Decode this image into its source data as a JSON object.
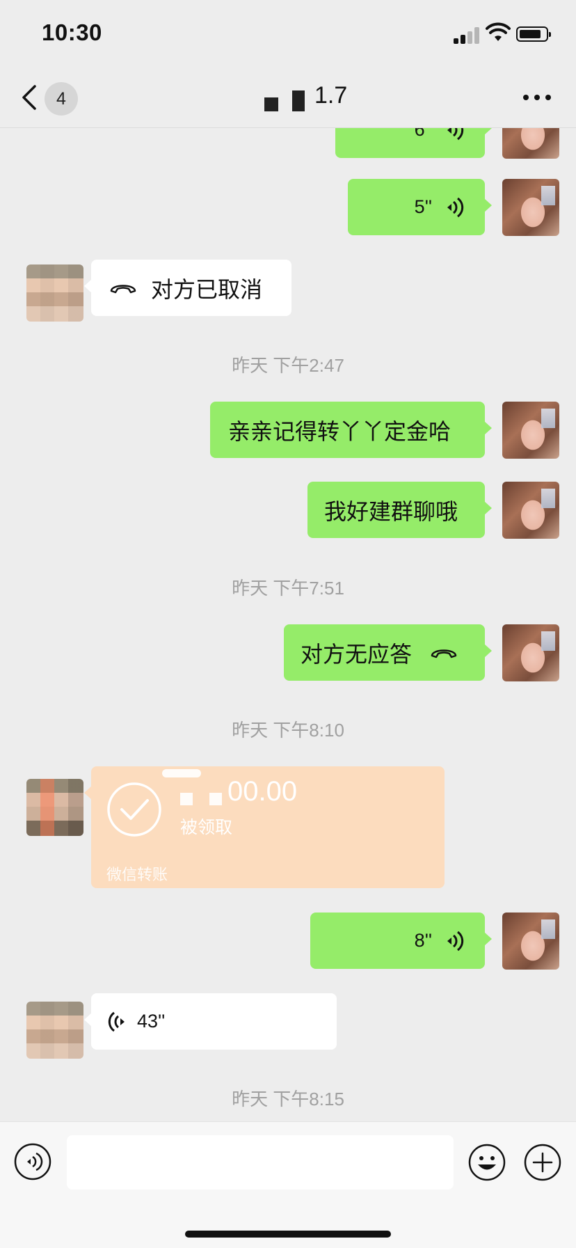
{
  "status_bar": {
    "time": "10:30"
  },
  "header": {
    "unread_count": "4",
    "title": "1.7"
  },
  "messages": {
    "voice_top": {
      "duration": "6''"
    },
    "voice_1": {
      "duration": "5''"
    },
    "call_cancelled": {
      "text": "对方已取消"
    },
    "ts_1": "昨天 下午2:47",
    "text_1": "亲亲记得转丫丫定金哈",
    "text_2": "我好建群聊哦",
    "ts_2": "昨天 下午7:51",
    "call_no_answer": {
      "text": "对方无应答"
    },
    "ts_3": "昨天 下午8:10",
    "transfer": {
      "amount": "00.00",
      "status": "被领取",
      "footer": "微信转账"
    },
    "voice_2": {
      "duration": "8''"
    },
    "voice_3": {
      "duration": "43''"
    },
    "ts_4": "昨天 下午8:15"
  },
  "input_bar": {
    "placeholder": ""
  }
}
